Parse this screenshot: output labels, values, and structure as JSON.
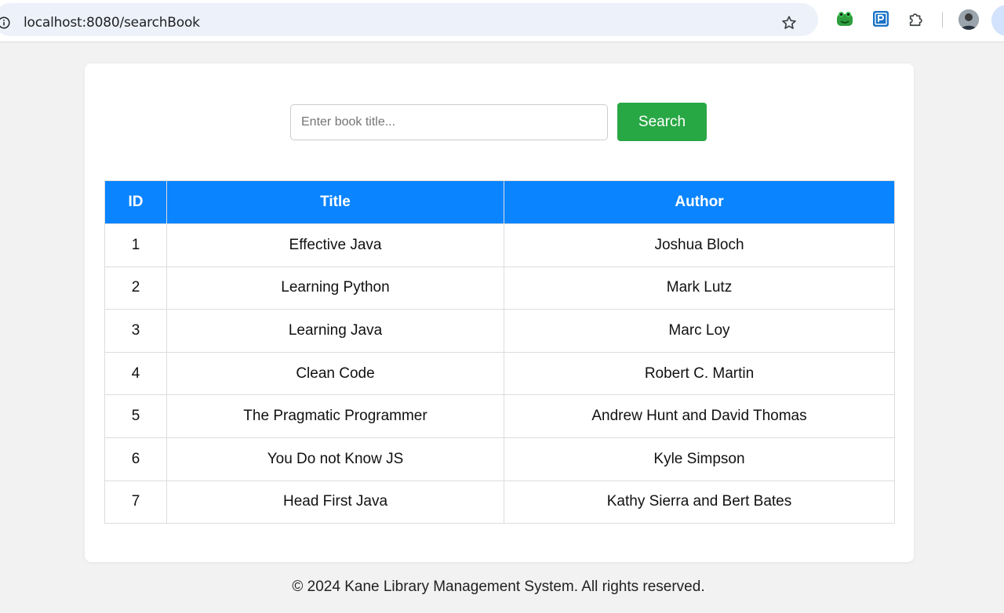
{
  "browser": {
    "url": "localhost:8080/searchBook",
    "icons": [
      "info-icon",
      "bookmark-star-icon",
      "frog-extension-icon",
      "p-extension-icon",
      "puzzle-extensions-icon",
      "profile-avatar"
    ]
  },
  "search": {
    "placeholder": "Enter book title...",
    "value": "",
    "button_label": "Search"
  },
  "table": {
    "headers": [
      "ID",
      "Title",
      "Author"
    ],
    "rows": [
      [
        "1",
        "Effective Java",
        "Joshua Bloch"
      ],
      [
        "2",
        "Learning Python",
        "Mark Lutz"
      ],
      [
        "3",
        "Learning Java",
        "Marc Loy"
      ],
      [
        "4",
        "Clean Code",
        "Robert C. Martin"
      ],
      [
        "5",
        "The Pragmatic Programmer",
        "Andrew Hunt and David Thomas"
      ],
      [
        "6",
        "You Do not Know JS",
        "Kyle Simpson"
      ],
      [
        "7",
        "Head First Java",
        "Kathy Sierra and Bert Bates"
      ]
    ]
  },
  "footer": {
    "text": "© 2024 Kane Library Management System. All rights reserved."
  },
  "colors": {
    "accent_header": "#0a84ff",
    "search_button": "#28a745",
    "page_background": "#f2f2f2"
  }
}
